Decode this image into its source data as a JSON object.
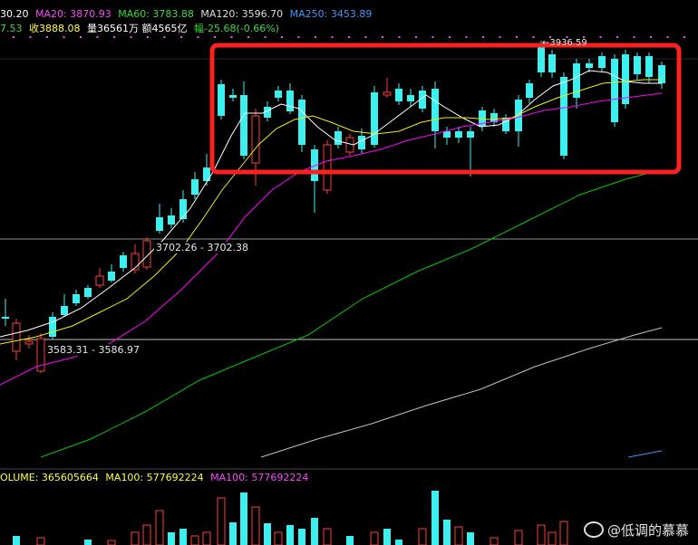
{
  "ma_line1": {
    "ma5_fragment": "30.20",
    "ma20": "MA20: 3870.93",
    "ma60": "MA60: 3783.88",
    "ma120": "MA120: 3596.70",
    "ma250": "MA250: 3453.89"
  },
  "ma_line2": {
    "open_fragment": "7.53",
    "close": "收3888.08",
    "volume": "量36561万",
    "amount": "额4565亿",
    "change": "幅-25.68(-0.66%)"
  },
  "price_labels": {
    "high": "3936.59",
    "level_a": "3702.26 - 3702.38",
    "level_b": "3583.31 - 3586.97"
  },
  "volume_header": {
    "volume": "OLUME: 365605664",
    "ma100_a": "MA100: 577692224",
    "ma100_b": "MA100: 577692224"
  },
  "watermark": "@低调的慕慕",
  "colors": {
    "up": "#ff3c3c",
    "down": "#3cf0f0",
    "ma5": "#ffffff",
    "ma10": "#f0f000",
    "ma20": "#ff00ff",
    "ma60": "#00c800",
    "ma120": "#c0c0c0",
    "highlight_box": "#ff2020"
  }
}
